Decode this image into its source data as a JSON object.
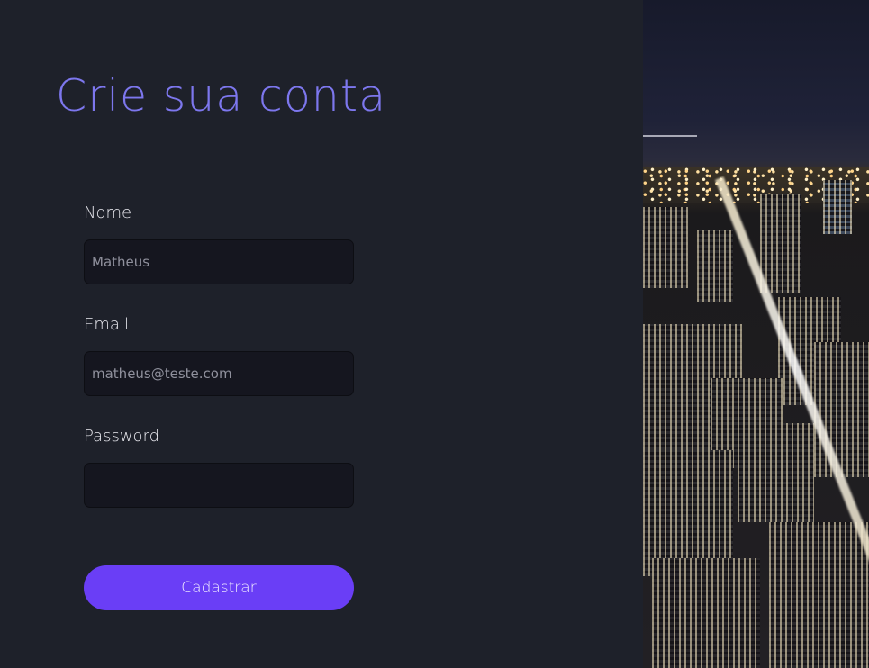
{
  "page": {
    "title": "Crie sua conta"
  },
  "form": {
    "name": {
      "label": "Nome",
      "placeholder": "Matheus"
    },
    "email": {
      "label": "Email",
      "placeholder": "matheus@teste.com"
    },
    "password": {
      "label": "Password",
      "placeholder": ""
    },
    "submit_label": "Cadastrar"
  },
  "colors": {
    "background": "#1e212a",
    "title": "#7d77ee",
    "accent": "#6a3ef6",
    "input_background": "#15161f"
  }
}
